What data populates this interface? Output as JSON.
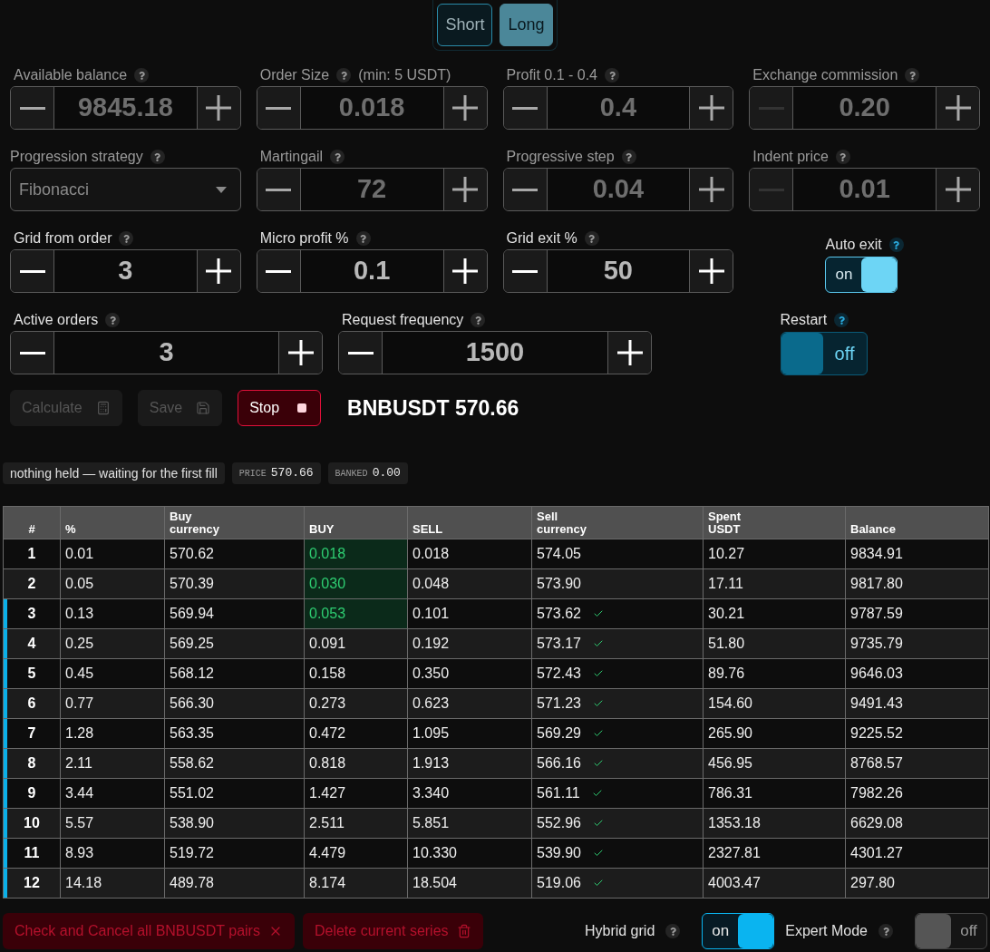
{
  "direction_tabs": [
    {
      "label": "Short",
      "selected": false
    },
    {
      "label": "Long",
      "selected": true
    }
  ],
  "settings": [
    [
      {
        "kind": "stepper",
        "label": "Available balance",
        "value": "9845.18",
        "disabled": true,
        "decrement_disabled": false
      },
      {
        "kind": "stepper",
        "label": "Order Size",
        "note": "(min: 5 USDT)",
        "value": "0.018",
        "disabled": true,
        "decrement_disabled": false
      },
      {
        "kind": "stepper",
        "label": "Profit 0.1 - 0.4",
        "value": "0.4",
        "disabled": true,
        "decrement_disabled": false
      },
      {
        "kind": "stepper",
        "label": "Exchange commission",
        "value": "0.20",
        "disabled": true,
        "decrement_disabled": true
      }
    ],
    [
      {
        "kind": "select",
        "label": "Progression strategy",
        "value": "Fibonacci",
        "disabled": true
      },
      {
        "kind": "stepper",
        "label": "Martingail",
        "value": "72",
        "disabled": true,
        "decrement_disabled": false
      },
      {
        "kind": "stepper",
        "label": "Progressive step",
        "value": "0.04",
        "disabled": true,
        "decrement_disabled": false
      },
      {
        "kind": "stepper",
        "label": "Indent price",
        "value": "0.01",
        "disabled": true,
        "decrement_disabled": true
      }
    ],
    [
      {
        "kind": "stepper",
        "label": "Grid from order",
        "value": "3",
        "disabled": false,
        "decrement_disabled": false
      },
      {
        "kind": "stepper",
        "label": "Micro profit %",
        "value": "0.1",
        "disabled": false,
        "decrement_disabled": false
      },
      {
        "kind": "stepper",
        "label": "Grid exit %",
        "value": "50",
        "disabled": false,
        "decrement_disabled": false
      },
      {
        "kind": "toggle",
        "label": "Auto exit",
        "on": true,
        "text": "on"
      }
    ],
    [
      {
        "kind": "stepper",
        "label": "Active orders",
        "value": "3",
        "disabled": false,
        "decrement_disabled": false
      },
      {
        "kind": "stepper",
        "label": "Request frequency",
        "value": "1500",
        "disabled": false,
        "decrement_disabled": false
      },
      {
        "kind": "toggle",
        "label": "Restart",
        "on": false,
        "text": "off"
      }
    ]
  ],
  "actions": [
    {
      "kind": "calculate",
      "label": "Calculate",
      "disabled": true
    },
    {
      "kind": "save",
      "label": "Save",
      "disabled": true
    },
    {
      "kind": "stop",
      "label": "Stop",
      "disabled": false
    }
  ],
  "ticker": "BNBUSDT 570.66",
  "status_chips": [
    {
      "kind": "text",
      "text": "nothing held — waiting for the first fill"
    },
    {
      "kind": "stat",
      "label": "PRICE",
      "value": "570.66"
    },
    {
      "kind": "stat",
      "label": "BANKED",
      "value": "0.00"
    }
  ],
  "table": {
    "columns": [
      "#",
      "%",
      "Buy currency",
      "BUY",
      "SELL",
      "Sell currency",
      "Spent USDT",
      "Balance"
    ],
    "rows": [
      {
        "cells": [
          "1",
          "0.01",
          "570.62",
          "0.018",
          "0.018",
          "574.05",
          "10.27",
          "9834.91"
        ],
        "active": false,
        "buy_filled": true,
        "sell_placed": false
      },
      {
        "cells": [
          "2",
          "0.05",
          "570.39",
          "0.030",
          "0.048",
          "573.90",
          "17.11",
          "9817.80"
        ],
        "active": false,
        "buy_filled": true,
        "sell_placed": false
      },
      {
        "cells": [
          "3",
          "0.13",
          "569.94",
          "0.053",
          "0.101",
          "573.62",
          "30.21",
          "9787.59"
        ],
        "active": true,
        "buy_filled": true,
        "sell_placed": true
      },
      {
        "cells": [
          "4",
          "0.25",
          "569.25",
          "0.091",
          "0.192",
          "573.17",
          "51.80",
          "9735.79"
        ],
        "active": true,
        "buy_filled": false,
        "sell_placed": true
      },
      {
        "cells": [
          "5",
          "0.45",
          "568.12",
          "0.158",
          "0.350",
          "572.43",
          "89.76",
          "9646.03"
        ],
        "active": true,
        "buy_filled": false,
        "sell_placed": true
      },
      {
        "cells": [
          "6",
          "0.77",
          "566.30",
          "0.273",
          "0.623",
          "571.23",
          "154.60",
          "9491.43"
        ],
        "active": true,
        "buy_filled": false,
        "sell_placed": true
      },
      {
        "cells": [
          "7",
          "1.28",
          "563.35",
          "0.472",
          "1.095",
          "569.29",
          "265.90",
          "9225.52"
        ],
        "active": true,
        "buy_filled": false,
        "sell_placed": true
      },
      {
        "cells": [
          "8",
          "2.11",
          "558.62",
          "0.818",
          "1.913",
          "566.16",
          "456.95",
          "8768.57"
        ],
        "active": true,
        "buy_filled": false,
        "sell_placed": true
      },
      {
        "cells": [
          "9",
          "3.44",
          "551.02",
          "1.427",
          "3.340",
          "561.11",
          "786.31",
          "7982.26"
        ],
        "active": true,
        "buy_filled": false,
        "sell_placed": true
      },
      {
        "cells": [
          "10",
          "5.57",
          "538.90",
          "2.511",
          "5.851",
          "552.96",
          "1353.18",
          "6629.08"
        ],
        "active": true,
        "buy_filled": false,
        "sell_placed": true
      },
      {
        "cells": [
          "11",
          "8.93",
          "519.72",
          "4.479",
          "10.330",
          "539.90",
          "2327.81",
          "4301.27"
        ],
        "active": true,
        "buy_filled": false,
        "sell_placed": true
      },
      {
        "cells": [
          "12",
          "14.18",
          "489.78",
          "8.174",
          "18.504",
          "519.06",
          "4003.47",
          "297.80"
        ],
        "active": true,
        "buy_filled": false,
        "sell_placed": true
      }
    ]
  },
  "footer": {
    "buttons": [
      {
        "kind": "cancel",
        "label": "Check and Cancel all BNBUSDT pairs"
      },
      {
        "kind": "delete",
        "label": "Delete current series"
      }
    ],
    "toggles": [
      {
        "label": "Hybrid grid",
        "on": true,
        "text": "on"
      },
      {
        "label": "Expert Mode",
        "on": false,
        "text": "off"
      }
    ]
  }
}
